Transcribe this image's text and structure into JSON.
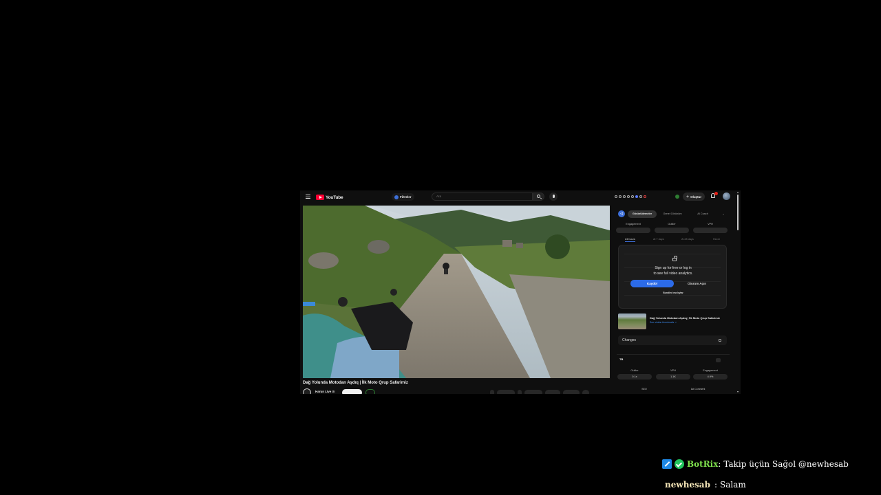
{
  "youtube": {
    "logo_text": "YouTube",
    "filter_label": "Filtreler",
    "search_placeholder": "Ara",
    "create_label": "Oluştur",
    "icons": [
      "menu-icon",
      "search-icon",
      "mic-icon",
      "bell-icon",
      "plus-icon"
    ],
    "accent": "#ff0033"
  },
  "video": {
    "title": "Dağ Yolunda Motodan Aşdıq | İlk Moto Qrup Safarimiz",
    "channel": "Harun Live ⊙"
  },
  "analytics": {
    "tabs": [
      "Görüntülemeler",
      "Genel Görünüm",
      "AI Coach"
    ],
    "stats": [
      "Engagement",
      "Outlier",
      "VPH"
    ],
    "ranges": [
      "24 hours",
      "Ai 7 days",
      "Ai 28 days",
      "Hecni"
    ],
    "lock_line1": "Sign up for free or log in",
    "lock_line2": "to see full video analytics.",
    "signup_label": "Kaydol",
    "login_label": "Oturum Açın",
    "small_link": "Bundled ma bytar",
    "mini_video_title": "Dağ Yolunda Motodan Aşdıq | İlk Moto Qrup Safarimiz",
    "mini_video_link": "See similar thumbnails ↗",
    "changes_label": "Changes",
    "accent": "#2c6be8"
  },
  "card2": {
    "logo": "TB",
    "heads": [
      "Outlier",
      "VPH",
      "Engagement"
    ],
    "values": [
      "0.1x",
      "1.1K",
      "4.9%"
    ],
    "sub_labels": [
      "SEO",
      "1st Comment"
    ]
  },
  "chat": [
    {
      "user": "BotRix",
      "separator": ":",
      "message": "Takip üçün Sağol @newhesab",
      "color": "#7ee04d"
    },
    {
      "user": "newhesab",
      "separator": ":",
      "message": "Salam",
      "color": "#f5e6b8"
    }
  ]
}
